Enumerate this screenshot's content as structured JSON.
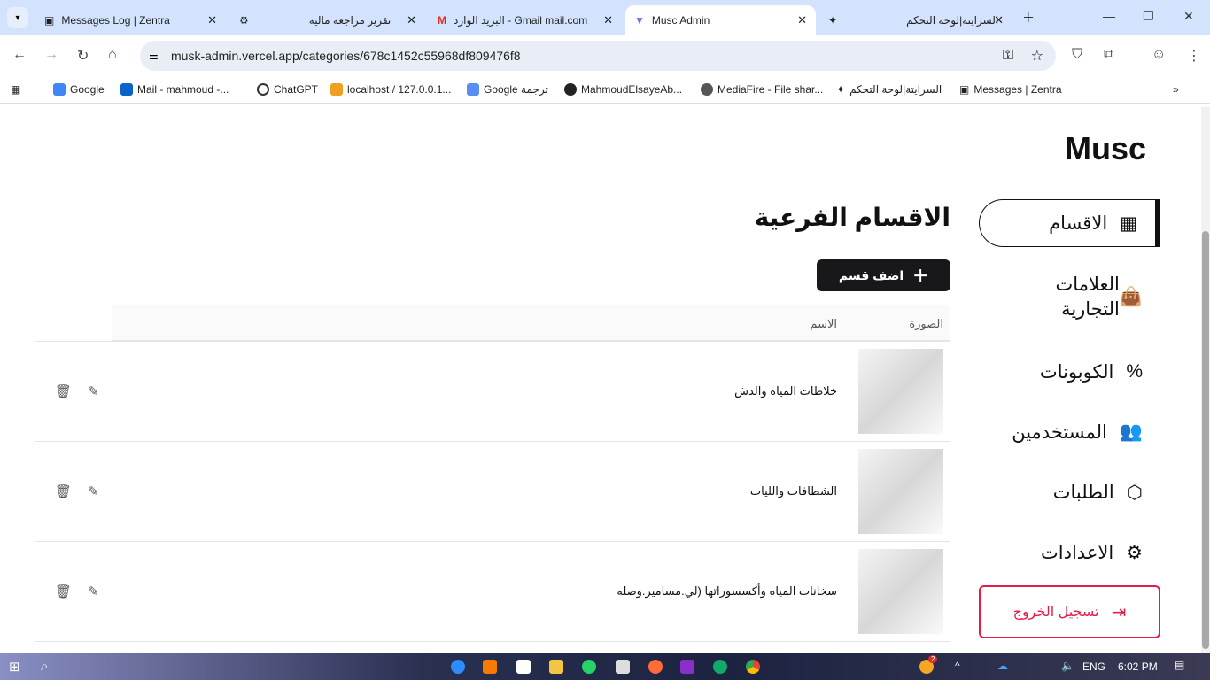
{
  "browser": {
    "tabs": [
      {
        "title": "Messages Log | Zentra",
        "icon": "zentra-icon"
      },
      {
        "title": "تقرير مراجعة مالية",
        "icon": "chatgpt-icon"
      },
      {
        "title": "البريد الوارد - Gmail mail.com",
        "icon": "gmail-icon"
      },
      {
        "title": "Musc Admin",
        "icon": "vite-icon",
        "active": true
      },
      {
        "title": "السرايتة|لوحة التحكم",
        "icon": "sparkle-icon"
      }
    ],
    "url": "musk-admin.vercel.app/categories/678c1452c55968df809476f8",
    "bookmarks": [
      "Google",
      "Mail - mahmoud -...",
      "ChatGPT",
      "localhost / 127.0.0.1...",
      "Google ترجمة",
      "MahmoudElsayeAb...",
      "MediaFire - File shar...",
      "السرايتة|لوحة التحكم",
      "Messages | Zentra"
    ]
  },
  "app": {
    "logo": "Musc",
    "sidebar": [
      {
        "label": "الاقسام",
        "icon": "grid-icon",
        "active": true
      },
      {
        "label": "العلامات التجارية",
        "icon": "shopping-bag-icon"
      },
      {
        "label": "الكوبونات",
        "icon": "percent-icon"
      },
      {
        "label": "المستخدمين",
        "icon": "users-icon"
      },
      {
        "label": "الطلبات",
        "icon": "package-icon"
      },
      {
        "label": "الاعدادات",
        "icon": "gear-icon"
      }
    ],
    "logout": "تسجيل الخروج",
    "title": "الاقسام الفرعية",
    "add_button": "اضف قسم",
    "columns": {
      "image": "الصورة",
      "name": "الاسم"
    },
    "rows": [
      {
        "name": "خلاطات المياه والدش"
      },
      {
        "name": "الشطافات والليات"
      },
      {
        "name": "سخانات المياه وأكسسوراتها (لي.مسامير.وصله"
      }
    ]
  },
  "taskbar": {
    "lang": "ENG",
    "time": "6:02 PM",
    "badge": "2"
  }
}
